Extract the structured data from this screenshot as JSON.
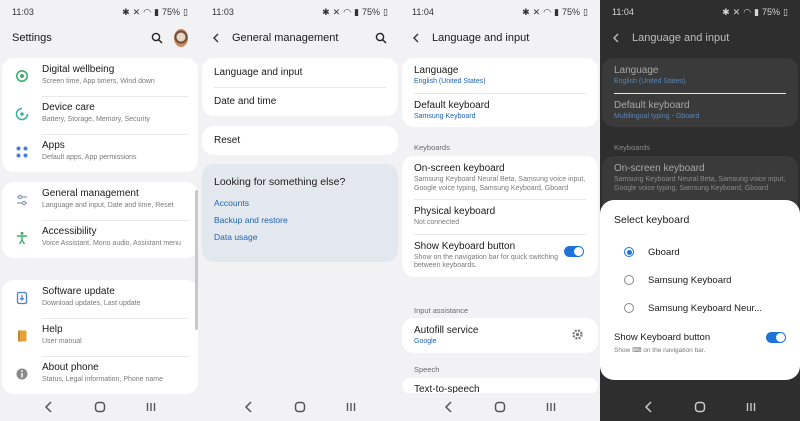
{
  "colors": {
    "accent": "#1d73d8",
    "link": "#1d63b8",
    "background": "#f2f2f4",
    "dim": "#2e2e2e"
  },
  "screen1": {
    "time": "11:03",
    "battery": "75%",
    "title": "Settings",
    "icons": [
      "search-icon",
      "avatar"
    ],
    "groups": [
      [
        {
          "title": "Digital wellbeing",
          "sub": "Screen time, App timers, Wind down",
          "icon": "digital-wellbeing-icon",
          "color": "#3bb06a"
        },
        {
          "title": "Device care",
          "sub": "Battery, Storage, Memory, Security",
          "icon": "device-care-icon",
          "color": "#3bb0a0"
        },
        {
          "title": "Apps",
          "sub": "Default apps, App permissions",
          "icon": "apps-icon",
          "color": "#4a7fd6"
        }
      ],
      [
        {
          "title": "General management",
          "sub": "Language and input, Date and time, Reset",
          "icon": "general-management-icon",
          "color": "#8a9bb5"
        },
        {
          "title": "Accessibility",
          "sub": "Voice Assistant, Mono audio, Assistant menu",
          "icon": "accessibility-icon",
          "color": "#3bb06a"
        }
      ],
      [
        {
          "title": "Software update",
          "sub": "Download updates, Last update",
          "icon": "software-update-icon",
          "color": "#4a7fd6"
        },
        {
          "title": "Help",
          "sub": "User manual",
          "icon": "help-icon",
          "color": "#e3a23c"
        },
        {
          "title": "About phone",
          "sub": "Status, Legal information, Phone name",
          "icon": "about-phone-icon",
          "color": "#8a8a8a"
        }
      ]
    ]
  },
  "screen2": {
    "time": "11:03",
    "battery": "75%",
    "title": "General management",
    "items": [
      "Language and input",
      "Date and time"
    ],
    "reset": "Reset",
    "look": {
      "title": "Looking for something else?",
      "links": [
        "Accounts",
        "Backup and restore",
        "Data usage"
      ]
    }
  },
  "screen3": {
    "time": "11:04",
    "battery": "75%",
    "title": "Language and input",
    "top": [
      {
        "title": "Language",
        "sub": "English (United States)"
      },
      {
        "title": "Default keyboard",
        "sub": "Samsung Keyboard"
      }
    ],
    "keyboards_label": "Keyboards",
    "keyboards": [
      {
        "title": "On-screen keyboard",
        "sub": "Samsung Keyboard Neural Beta, Samsung voice input, Google voice typing, Samsung Keyboard, Gboard"
      },
      {
        "title": "Physical keyboard",
        "sub": "Not connected"
      },
      {
        "title": "Show Keyboard button",
        "sub": "Show on the navigation bar for quick switching between keyboards."
      }
    ],
    "input_assistance_label": "Input assistance",
    "autofill": {
      "title": "Autofill service",
      "sub": "Google"
    },
    "speech_label": "Speech",
    "tts": "Text-to-speech"
  },
  "screen4": {
    "time": "11:04",
    "battery": "75%",
    "title": "Language and input",
    "bg": [
      {
        "title": "Language",
        "sub": "English (United States)"
      },
      {
        "title": "Default keyboard",
        "sub": "Multilingual typing - Gboard"
      }
    ],
    "keyboards_label": "Keyboards",
    "bg_kb": {
      "title": "On-screen keyboard",
      "sub": "Samsung Keyboard Neural Beta, Samsung voice input, Google voice typing, Samsung Keyboard, Gboard"
    },
    "sheet": {
      "title": "Select keyboard",
      "options": [
        "Gboard",
        "Samsung Keyboard",
        "Samsung Keyboard Neur..."
      ],
      "selected": 0,
      "show_button": "Show Keyboard button",
      "show_sub": "Show ⌨ on the navigation bar."
    }
  },
  "nav": {
    "back": "‹",
    "home": "○",
    "recents": "|||"
  }
}
